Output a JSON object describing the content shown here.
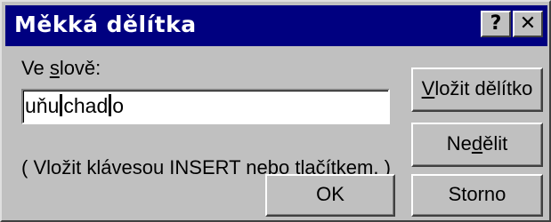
{
  "window": {
    "title": "Měkká dělítka",
    "help_glyph": "?",
    "close_glyph": "✕"
  },
  "word_label": {
    "pre": "Ve ",
    "underlined": "s",
    "post": "lově:"
  },
  "word_field": {
    "parts": [
      "uňu",
      "chad",
      "o"
    ]
  },
  "hint": "( Vložit klávesou INSERT nebo tlačítkem. )",
  "buttons": {
    "insert": {
      "underlined": "V",
      "post": "ložit dělítko"
    },
    "nosplit": {
      "pre": "Ne",
      "underlined": "d",
      "post": "ělit"
    },
    "ok": "OK",
    "cancel": "Storno"
  },
  "icons": [
    "help-icon",
    "close-icon"
  ]
}
